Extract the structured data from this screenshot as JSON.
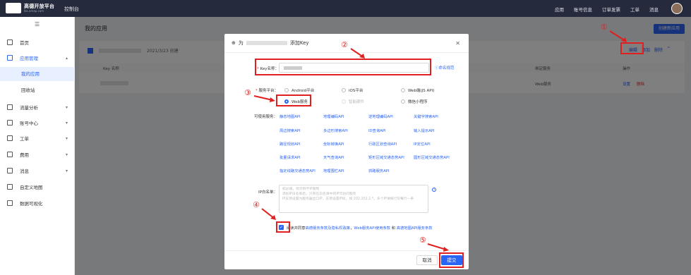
{
  "topbar": {
    "logo_text": "高德开放平台",
    "logo_sub": "lbs.amap.com",
    "console": "控制台",
    "nav": [
      "应用",
      "账号信息",
      "订单发票",
      "工单",
      "消息"
    ]
  },
  "sidebar": {
    "items": [
      {
        "label": "首页"
      },
      {
        "label": "应用管理"
      },
      {
        "label": "我的应用"
      },
      {
        "label": "回收站"
      },
      {
        "label": "流量分析"
      },
      {
        "label": "账号中心"
      },
      {
        "label": "工单"
      },
      {
        "label": "费用"
      },
      {
        "label": "消息"
      },
      {
        "label": "自定义地图"
      },
      {
        "label": "数据可视化"
      }
    ]
  },
  "main": {
    "title": "我的应用",
    "create_button": "创建新应用",
    "card": {
      "date": "2021/3/23 创建",
      "actions": {
        "edit": "编辑",
        "add": "添加",
        "delete": "删除"
      },
      "columns": {
        "key_name": "Key 名称",
        "service_bound": "绑定服务",
        "op": "操作"
      },
      "row": {
        "service": "Web服务",
        "setting": "设置",
        "delete": "删除"
      }
    }
  },
  "modal": {
    "title_prefix": "为",
    "title_suffix": "添加Key",
    "key_name_label": "Key名称：",
    "naming_link": "命名规范",
    "platform_label": "服务平台：",
    "platforms": [
      "Android平台",
      "iOS平台",
      "Web端(JS API)",
      "Web服务",
      "智能硬件",
      "微信小程序"
    ],
    "services_label": "可使用服务：",
    "services": [
      "静态地图API",
      "地理编码API",
      "逆地理编码API",
      "关键字搜索API",
      "周边搜索API",
      "多边形搜索API",
      "ID查询API",
      "输入提示API",
      "路径规划API",
      "坐标转换API",
      "行政区划查询API",
      "IP定位API",
      "批量请求API",
      "天气查询API",
      "矩形区域交通态势API",
      "圆形区域交通态势API",
      "指定线路交通态势API",
      "地理围栏API",
      "抓路服务API"
    ],
    "ip_label": "IP白名单：",
    "ip_placeholder": "如必填，则示例不IP限制\n添加IP白名单后，只有在白名单中的IP可访问服务\n IP支持设置为服务器出口IP，支持设置IP段，如 202.202.2.*，多个IP请换行写每行一条",
    "agree_prefix": "阅读并同意",
    "agree_link1": "高德服务条款及隐私权政策",
    "agree_sep": "，",
    "agree_link2": "Web服务API使用条款",
    "agree_and": "和",
    "agree_link3": "高德地图API服务条款",
    "cancel": "取消",
    "submit": "提交"
  },
  "annotations": [
    "①",
    "②",
    "③",
    "④",
    "⑤"
  ],
  "colors": {
    "accent": "#2a64f6",
    "annotation": "#e02020",
    "topbar": "#252a3d"
  }
}
